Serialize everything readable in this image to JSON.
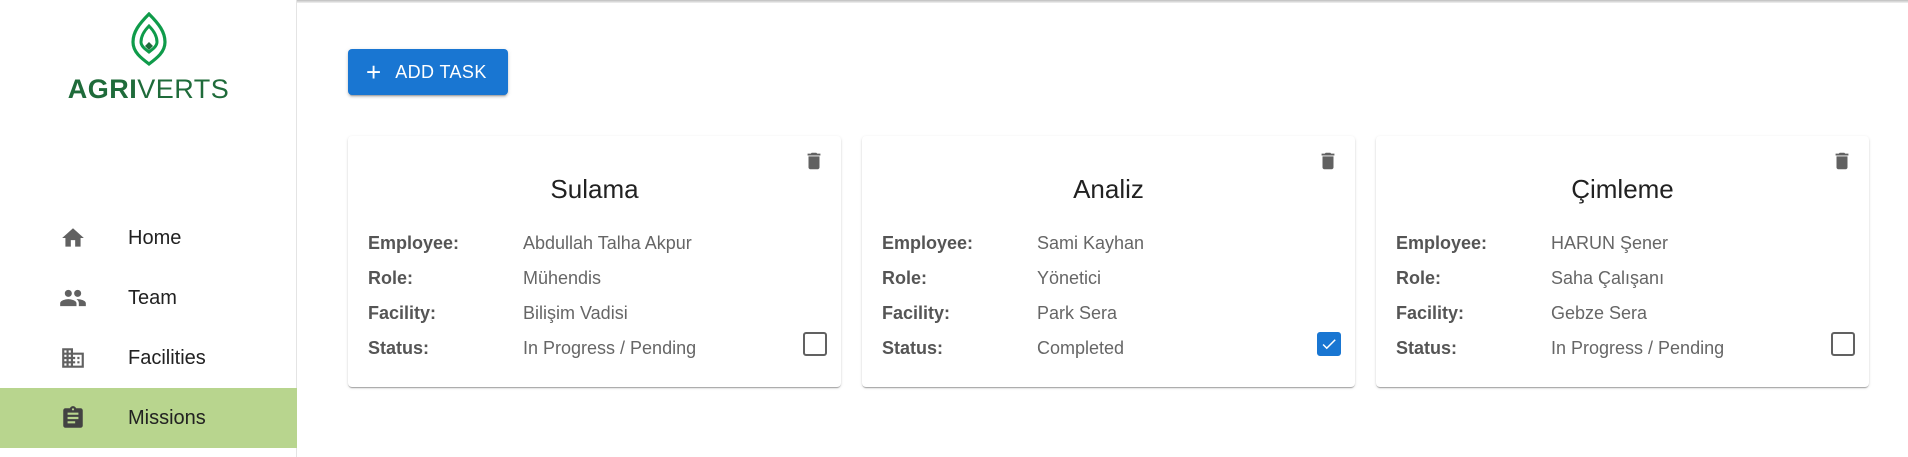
{
  "brand": {
    "name_bold": "AGRI",
    "name_light": "VERTS",
    "accent_color": "#0f9b4a"
  },
  "sidebar": {
    "active_color": "#b8d58e",
    "items": [
      {
        "label": "Home",
        "icon": "home-icon"
      },
      {
        "label": "Team",
        "icon": "people-icon"
      },
      {
        "label": "Facilities",
        "icon": "building-icon"
      },
      {
        "label": "Missions",
        "icon": "clipboard-icon",
        "active": true
      }
    ]
  },
  "toolbar": {
    "add_label": "ADD TASK",
    "add_icon": "plus-icon",
    "button_color": "#1976d2"
  },
  "field_labels": {
    "employee": "Employee:",
    "role": "Role:",
    "facility": "Facility:",
    "status": "Status:"
  },
  "tasks": [
    {
      "title": "Sulama",
      "employee": "Abdullah Talha Akpur",
      "role": "Mühendis",
      "facility": "Bilişim Vadisi",
      "status": "In Progress / Pending",
      "completed": false
    },
    {
      "title": "Analiz",
      "employee": "Sami Kayhan",
      "role": "Yönetici",
      "facility": "Park Sera",
      "status": "Completed",
      "completed": true
    },
    {
      "title": "Çimleme",
      "employee": "HARUN Şener",
      "role": "Saha Çalışanı",
      "facility": "Gebze Sera",
      "status": "In Progress / Pending",
      "completed": false
    }
  ]
}
